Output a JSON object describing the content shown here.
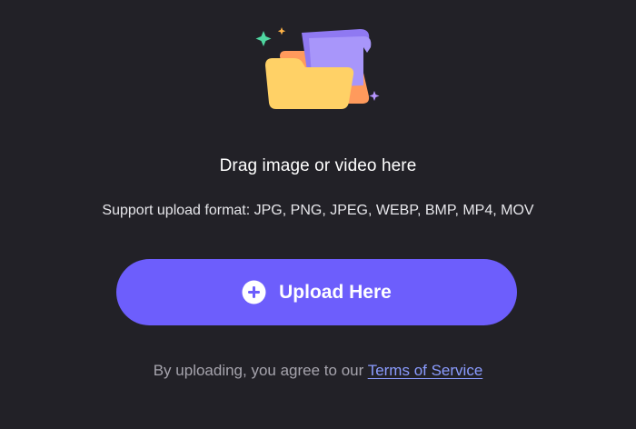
{
  "upload_area": {
    "drag_text": "Drag image or video here",
    "format_text": "Support upload format: JPG, PNG, JPEG, WEBP, BMP, MP4, MOV",
    "button_label": "Upload Here",
    "terms_prefix": "By uploading, you agree to our ",
    "terms_link": "Terms of Service"
  },
  "icons": {
    "illustration": "folder-with-documents-icon",
    "button": "plus-circle-icon"
  },
  "colors": {
    "background": "#222127",
    "button": "#6d5efc",
    "link": "#8b9cff",
    "folder_front": "#ffd166",
    "folder_back": "#ff9a5c",
    "paper": "#9b86f7",
    "sparkle_green": "#4fd6a0",
    "sparkle_orange": "#ffb347",
    "sparkle_purple": "#b695ff"
  }
}
